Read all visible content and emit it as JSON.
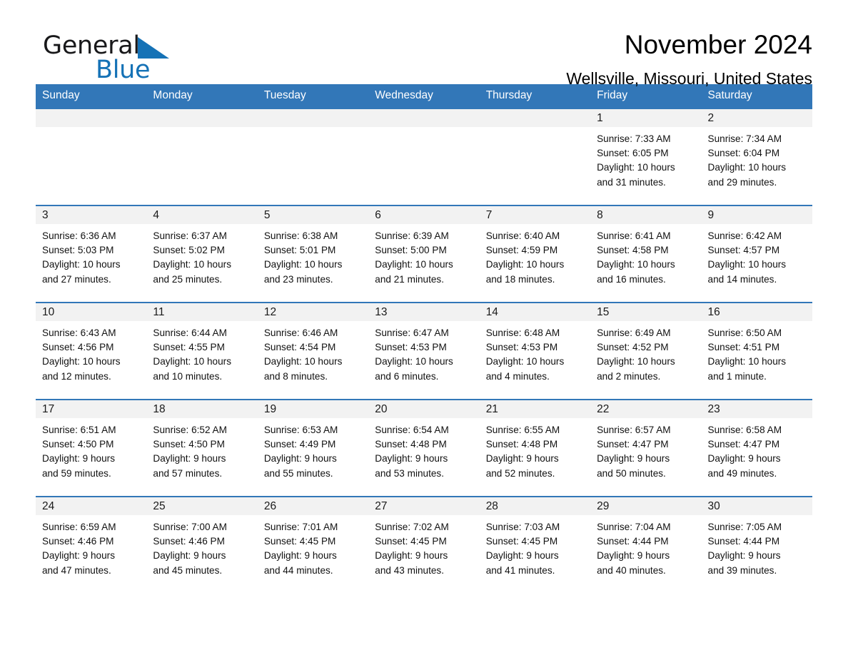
{
  "brand": {
    "name_part1": "General",
    "name_part2": "Blue",
    "triangle_color": "#1572b6"
  },
  "header": {
    "title": "November 2024",
    "subtitle": "Wellsville, Missouri, United States",
    "header_bg_color": "#3277b8",
    "row_border_color": "#3277b8",
    "daynum_band_color": "#f2f2f2"
  },
  "weekdays": [
    "Sunday",
    "Monday",
    "Tuesday",
    "Wednesday",
    "Thursday",
    "Friday",
    "Saturday"
  ],
  "labels": {
    "sunrise_prefix": "Sunrise:",
    "sunset_prefix": "Sunset:",
    "daylight_prefix": "Daylight:"
  },
  "weeks": [
    [
      {
        "day": "",
        "empty": true
      },
      {
        "day": "",
        "empty": true
      },
      {
        "day": "",
        "empty": true
      },
      {
        "day": "",
        "empty": true
      },
      {
        "day": "",
        "empty": true
      },
      {
        "day": "1",
        "sunrise": "Sunrise: 7:33 AM",
        "sunset": "Sunset: 6:05 PM",
        "daylight_line1": "Daylight: 10 hours",
        "daylight_line2": "and 31 minutes."
      },
      {
        "day": "2",
        "sunrise": "Sunrise: 7:34 AM",
        "sunset": "Sunset: 6:04 PM",
        "daylight_line1": "Daylight: 10 hours",
        "daylight_line2": "and 29 minutes."
      }
    ],
    [
      {
        "day": "3",
        "sunrise": "Sunrise: 6:36 AM",
        "sunset": "Sunset: 5:03 PM",
        "daylight_line1": "Daylight: 10 hours",
        "daylight_line2": "and 27 minutes."
      },
      {
        "day": "4",
        "sunrise": "Sunrise: 6:37 AM",
        "sunset": "Sunset: 5:02 PM",
        "daylight_line1": "Daylight: 10 hours",
        "daylight_line2": "and 25 minutes."
      },
      {
        "day": "5",
        "sunrise": "Sunrise: 6:38 AM",
        "sunset": "Sunset: 5:01 PM",
        "daylight_line1": "Daylight: 10 hours",
        "daylight_line2": "and 23 minutes."
      },
      {
        "day": "6",
        "sunrise": "Sunrise: 6:39 AM",
        "sunset": "Sunset: 5:00 PM",
        "daylight_line1": "Daylight: 10 hours",
        "daylight_line2": "and 21 minutes."
      },
      {
        "day": "7",
        "sunrise": "Sunrise: 6:40 AM",
        "sunset": "Sunset: 4:59 PM",
        "daylight_line1": "Daylight: 10 hours",
        "daylight_line2": "and 18 minutes."
      },
      {
        "day": "8",
        "sunrise": "Sunrise: 6:41 AM",
        "sunset": "Sunset: 4:58 PM",
        "daylight_line1": "Daylight: 10 hours",
        "daylight_line2": "and 16 minutes."
      },
      {
        "day": "9",
        "sunrise": "Sunrise: 6:42 AM",
        "sunset": "Sunset: 4:57 PM",
        "daylight_line1": "Daylight: 10 hours",
        "daylight_line2": "and 14 minutes."
      }
    ],
    [
      {
        "day": "10",
        "sunrise": "Sunrise: 6:43 AM",
        "sunset": "Sunset: 4:56 PM",
        "daylight_line1": "Daylight: 10 hours",
        "daylight_line2": "and 12 minutes."
      },
      {
        "day": "11",
        "sunrise": "Sunrise: 6:44 AM",
        "sunset": "Sunset: 4:55 PM",
        "daylight_line1": "Daylight: 10 hours",
        "daylight_line2": "and 10 minutes."
      },
      {
        "day": "12",
        "sunrise": "Sunrise: 6:46 AM",
        "sunset": "Sunset: 4:54 PM",
        "daylight_line1": "Daylight: 10 hours",
        "daylight_line2": "and 8 minutes."
      },
      {
        "day": "13",
        "sunrise": "Sunrise: 6:47 AM",
        "sunset": "Sunset: 4:53 PM",
        "daylight_line1": "Daylight: 10 hours",
        "daylight_line2": "and 6 minutes."
      },
      {
        "day": "14",
        "sunrise": "Sunrise: 6:48 AM",
        "sunset": "Sunset: 4:53 PM",
        "daylight_line1": "Daylight: 10 hours",
        "daylight_line2": "and 4 minutes."
      },
      {
        "day": "15",
        "sunrise": "Sunrise: 6:49 AM",
        "sunset": "Sunset: 4:52 PM",
        "daylight_line1": "Daylight: 10 hours",
        "daylight_line2": "and 2 minutes."
      },
      {
        "day": "16",
        "sunrise": "Sunrise: 6:50 AM",
        "sunset": "Sunset: 4:51 PM",
        "daylight_line1": "Daylight: 10 hours",
        "daylight_line2": "and 1 minute."
      }
    ],
    [
      {
        "day": "17",
        "sunrise": "Sunrise: 6:51 AM",
        "sunset": "Sunset: 4:50 PM",
        "daylight_line1": "Daylight: 9 hours",
        "daylight_line2": "and 59 minutes."
      },
      {
        "day": "18",
        "sunrise": "Sunrise: 6:52 AM",
        "sunset": "Sunset: 4:50 PM",
        "daylight_line1": "Daylight: 9 hours",
        "daylight_line2": "and 57 minutes."
      },
      {
        "day": "19",
        "sunrise": "Sunrise: 6:53 AM",
        "sunset": "Sunset: 4:49 PM",
        "daylight_line1": "Daylight: 9 hours",
        "daylight_line2": "and 55 minutes."
      },
      {
        "day": "20",
        "sunrise": "Sunrise: 6:54 AM",
        "sunset": "Sunset: 4:48 PM",
        "daylight_line1": "Daylight: 9 hours",
        "daylight_line2": "and 53 minutes."
      },
      {
        "day": "21",
        "sunrise": "Sunrise: 6:55 AM",
        "sunset": "Sunset: 4:48 PM",
        "daylight_line1": "Daylight: 9 hours",
        "daylight_line2": "and 52 minutes."
      },
      {
        "day": "22",
        "sunrise": "Sunrise: 6:57 AM",
        "sunset": "Sunset: 4:47 PM",
        "daylight_line1": "Daylight: 9 hours",
        "daylight_line2": "and 50 minutes."
      },
      {
        "day": "23",
        "sunrise": "Sunrise: 6:58 AM",
        "sunset": "Sunset: 4:47 PM",
        "daylight_line1": "Daylight: 9 hours",
        "daylight_line2": "and 49 minutes."
      }
    ],
    [
      {
        "day": "24",
        "sunrise": "Sunrise: 6:59 AM",
        "sunset": "Sunset: 4:46 PM",
        "daylight_line1": "Daylight: 9 hours",
        "daylight_line2": "and 47 minutes."
      },
      {
        "day": "25",
        "sunrise": "Sunrise: 7:00 AM",
        "sunset": "Sunset: 4:46 PM",
        "daylight_line1": "Daylight: 9 hours",
        "daylight_line2": "and 45 minutes."
      },
      {
        "day": "26",
        "sunrise": "Sunrise: 7:01 AM",
        "sunset": "Sunset: 4:45 PM",
        "daylight_line1": "Daylight: 9 hours",
        "daylight_line2": "and 44 minutes."
      },
      {
        "day": "27",
        "sunrise": "Sunrise: 7:02 AM",
        "sunset": "Sunset: 4:45 PM",
        "daylight_line1": "Daylight: 9 hours",
        "daylight_line2": "and 43 minutes."
      },
      {
        "day": "28",
        "sunrise": "Sunrise: 7:03 AM",
        "sunset": "Sunset: 4:45 PM",
        "daylight_line1": "Daylight: 9 hours",
        "daylight_line2": "and 41 minutes."
      },
      {
        "day": "29",
        "sunrise": "Sunrise: 7:04 AM",
        "sunset": "Sunset: 4:44 PM",
        "daylight_line1": "Daylight: 9 hours",
        "daylight_line2": "and 40 minutes."
      },
      {
        "day": "30",
        "sunrise": "Sunrise: 7:05 AM",
        "sunset": "Sunset: 4:44 PM",
        "daylight_line1": "Daylight: 9 hours",
        "daylight_line2": "and 39 minutes."
      }
    ]
  ]
}
